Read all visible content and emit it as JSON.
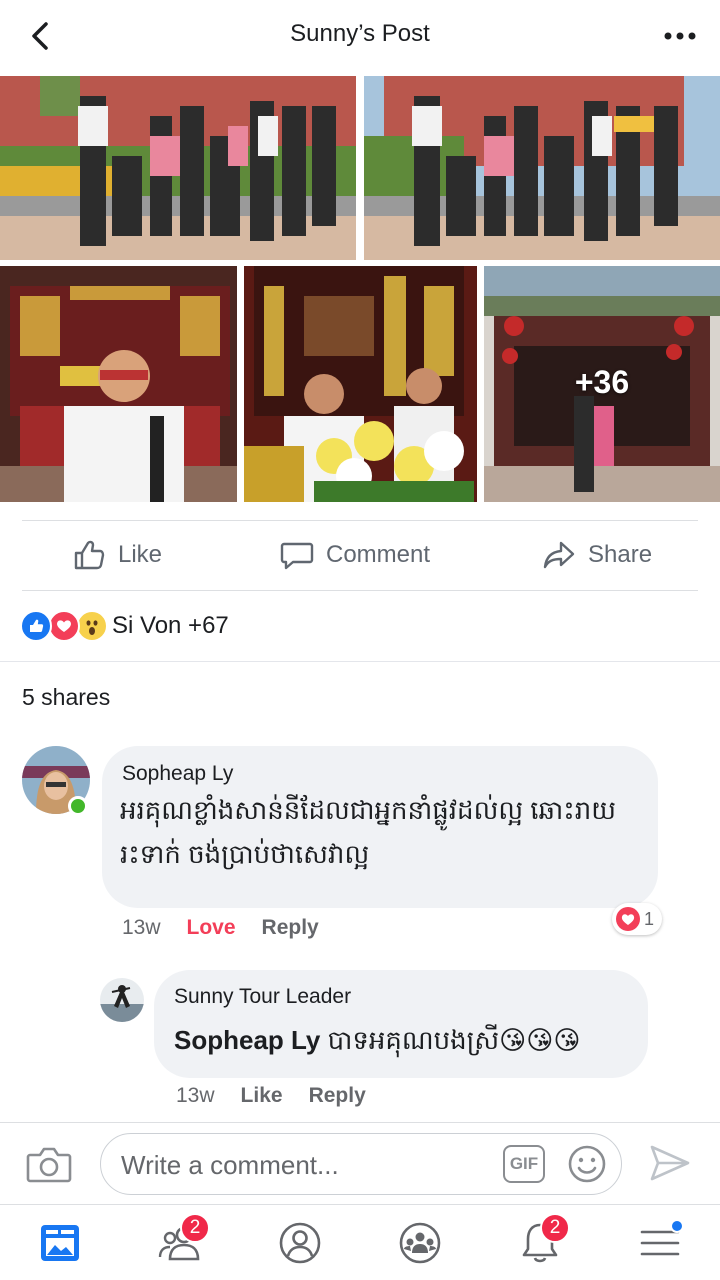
{
  "header": {
    "title": "Sunny’s Post",
    "back_icon": "back-arrow-icon",
    "more_icon": "more-dots-icon"
  },
  "photos": {
    "more_count": "+36"
  },
  "actions": {
    "like_label": "Like",
    "comment_label": "Comment",
    "share_label": "Share"
  },
  "reactions": {
    "summary": "Si Von +67",
    "icons": [
      "like-reaction-icon",
      "love-reaction-icon",
      "wow-reaction-icon"
    ]
  },
  "shares": {
    "text": "5 shares"
  },
  "comments": [
    {
      "author": "Sopheap Ly",
      "line1": "អរគុណខ្លាំងសាន់នីដែលជាអ្នកនាំផ្លូវដល់ល្អ ឆោះរាយ",
      "line2": "រះទាក់ ចង់ប្រាប់ថាសេវាល្អ",
      "time": "13w",
      "reaction_label": "Love",
      "reply_label": "Reply",
      "reaction_count": "1"
    },
    {
      "author": "Sunny Tour Leader",
      "mention": "Sopheap Ly",
      "text": " បាទអគុណបងស្រី😘😘😘",
      "time": "13w",
      "like_label": "Like",
      "reply_label": "Reply"
    }
  ],
  "composer": {
    "placeholder": "Write a comment...",
    "gif_label": "GIF"
  },
  "nav": {
    "items": [
      {
        "name": "news-feed",
        "badge": ""
      },
      {
        "name": "friends",
        "badge": "2"
      },
      {
        "name": "profile",
        "badge": ""
      },
      {
        "name": "groups",
        "badge": ""
      },
      {
        "name": "notifications",
        "badge": "2"
      },
      {
        "name": "menu",
        "badge": ""
      }
    ]
  },
  "colors": {
    "accent": "#1877f2",
    "love": "#f33e58",
    "badge": "#f02849",
    "online": "#42b72a"
  }
}
